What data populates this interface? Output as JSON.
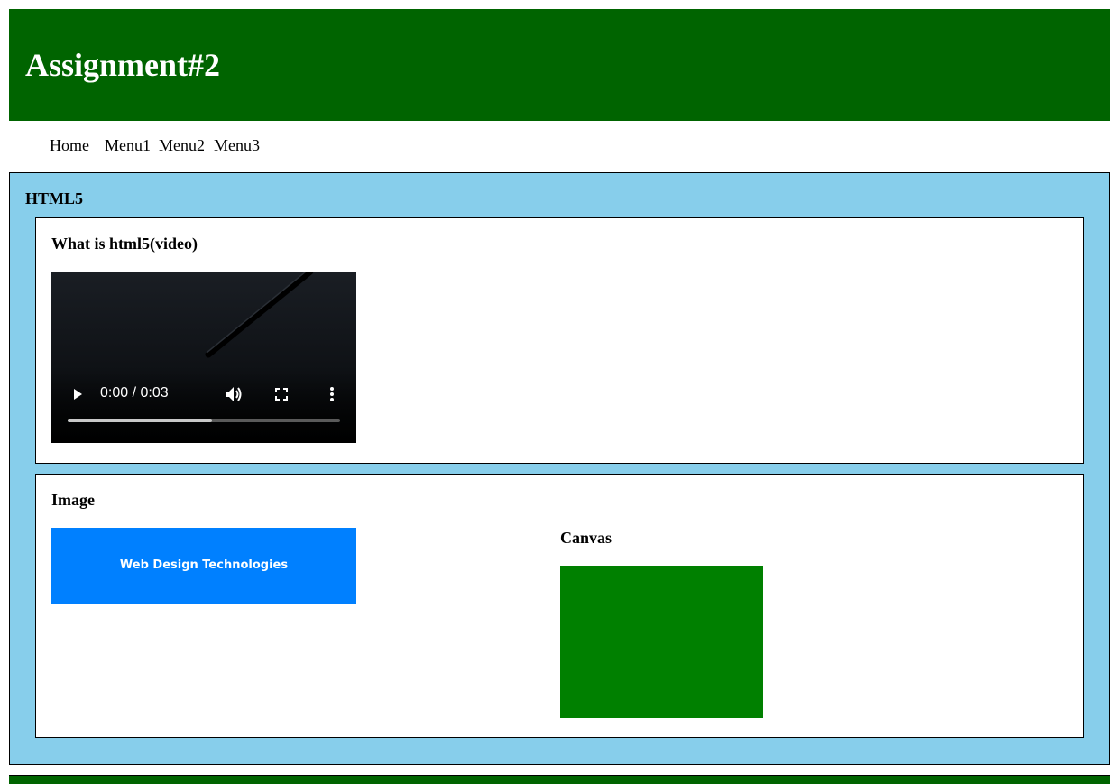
{
  "header": {
    "title": "Assignment#2"
  },
  "nav": {
    "items": [
      "Home",
      "Menu1",
      "Menu2",
      "Menu3"
    ]
  },
  "main": {
    "title": "HTML5",
    "video_section": {
      "title": "What is html5(video)",
      "video": {
        "time": "0:00 / 0:03",
        "progress_fraction": 0.53
      }
    },
    "image_section": {
      "title": "Image",
      "image_text": "Web Design Technologies",
      "canvas_title": "Canvas"
    }
  },
  "colors": {
    "header_bg": "#006400",
    "main_bg": "#87CEEB",
    "image_bg": "#0080FF",
    "canvas_fill": "#008000"
  },
  "icons": [
    "play-icon",
    "volume-icon",
    "fullscreen-icon",
    "more-options-icon"
  ]
}
